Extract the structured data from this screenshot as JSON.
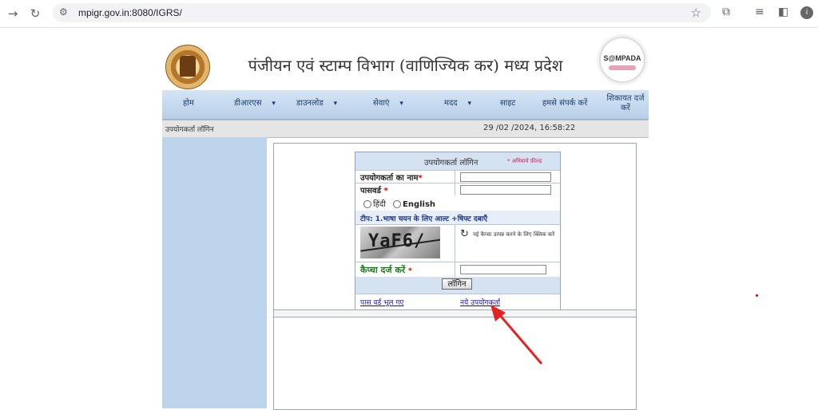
{
  "browser": {
    "url": "mpigr.gov.in:8080/IGRS/",
    "profile_initial": "i",
    "icons": [
      "forward-icon",
      "reload-icon",
      "site-info-icon",
      "star-icon",
      "extensions-icon",
      "reading-list-icon",
      "side-panel-icon",
      "profile-icon"
    ]
  },
  "header": {
    "title": "पंजीयन एवं स्टाम्प विभाग (वाणिज्यिक कर) मध्य प्रदेश",
    "logo_text": "S@MPADA"
  },
  "menu": {
    "items": [
      {
        "label": "होम",
        "dropdown": false
      },
      {
        "label": "डीआरएस",
        "dropdown": true
      },
      {
        "label": "डाउनलोड",
        "dropdown": true
      },
      {
        "label": "सेवाएं",
        "dropdown": true
      },
      {
        "label": "मदद",
        "dropdown": true
      },
      {
        "label": "साइट",
        "dropdown": false
      },
      {
        "label": "हमसे संपर्क करें",
        "dropdown": false
      },
      {
        "label": "शिकायत दर्ज करें",
        "dropdown": false
      }
    ]
  },
  "status": {
    "page_label": "उपयोगकर्ता लॉगिन",
    "datetime": "29 /02 /2024, 16:58:22"
  },
  "login": {
    "title": "उपयोगकर्ता लॉगिन",
    "required_note": "* अनिवार्य फ़ील्ड",
    "username_label": "उपयोगकर्ता का नाम",
    "password_label": "पासवर्ड",
    "required_mark": "*",
    "lang_hindi": "हिंदी",
    "lang_english": "English",
    "tip": "टीप: 1.भाषा चयन के लिए आल्ट +षिफ्ट दबाएँ",
    "captcha_value": "YaF6/",
    "refresh_text": "नई कैप्चा उत्पन्न करने के लिए क्लिक करें",
    "captcha_label": "कैप्चा दर्ज करें",
    "login_button": "लॉगिन",
    "forgot_password": "पास वर्ड भूल गए",
    "new_user": "नये उपयोगकर्ता"
  },
  "annotation": {
    "arrow_color": "#e52222",
    "dot_color": "#e60000"
  }
}
